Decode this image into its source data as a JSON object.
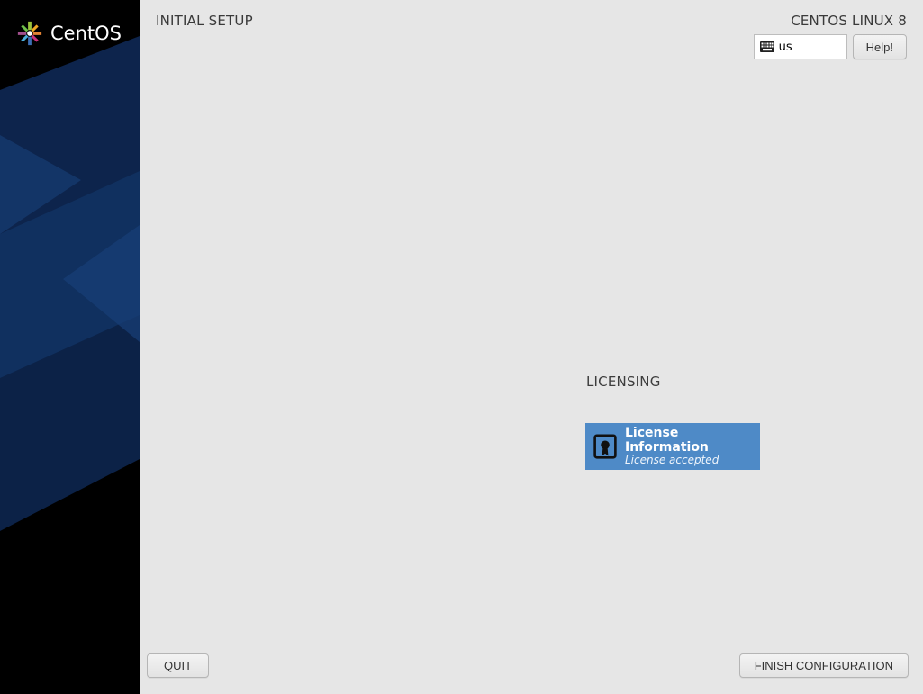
{
  "brand": {
    "name": "CentOS"
  },
  "header": {
    "title": "INITIAL SETUP",
    "os_name": "CENTOS LINUX 8",
    "keyboard_layout": "us",
    "help_label": "Help!"
  },
  "licensing": {
    "section_title": "LICENSING",
    "spoke_title": "License Information",
    "spoke_status": "License accepted"
  },
  "footer": {
    "quit_label": "QUIT",
    "finish_label": "FINISH CONFIGURATION"
  }
}
